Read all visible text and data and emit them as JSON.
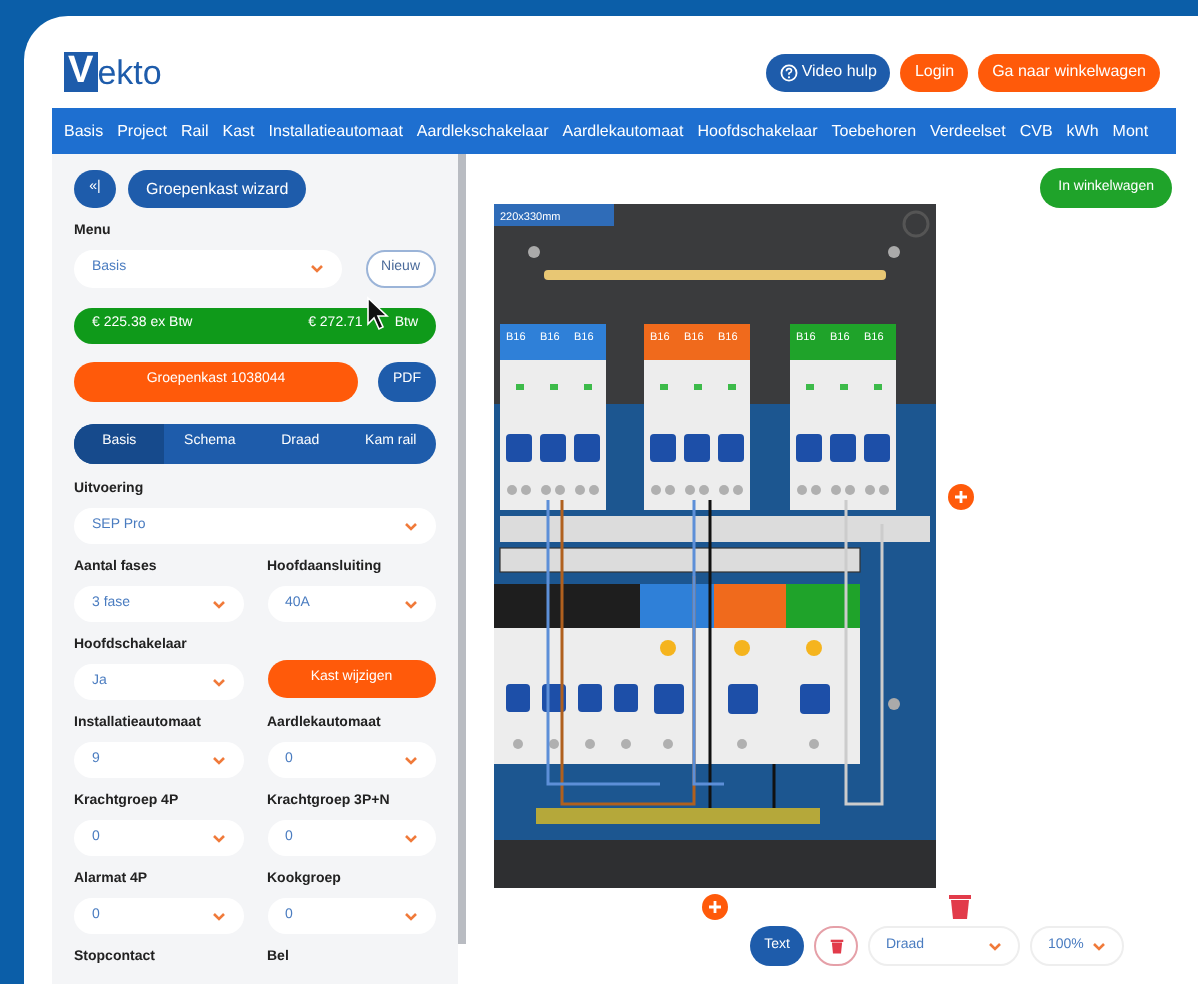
{
  "logo": {
    "initial": "V",
    "rest": "ekto"
  },
  "header_buttons": [
    {
      "label": "Video hulp",
      "kind": "help"
    },
    {
      "label": "Login",
      "kind": "orange"
    },
    {
      "label": "Ga naar winkelwagen",
      "kind": "orange"
    }
  ],
  "nav": [
    "Basis",
    "Project",
    "Rail",
    "Kast",
    "Installatieautomaat",
    "Aardlekschakelaar",
    "Aardlekautomaat",
    "Hoofdschakelaar",
    "Toebehoren",
    "Verdeelset",
    "CVB",
    "kWh",
    "Mont"
  ],
  "sidebar": {
    "collapse_button": "«|",
    "wizard_button": "Groepenkast wizard",
    "menu": {
      "label": "Menu",
      "value": "Basis",
      "new_button": "Nieuw"
    },
    "price": {
      "ex": "€ 225.38 ex Btw",
      "incl": "€ 272.71",
      "suffix": "Btw"
    },
    "project_button": "Groepenkast 1038044",
    "pdf_button": "PDF",
    "tabs": [
      {
        "label": "Basis",
        "selected": true
      },
      {
        "label": "Schema",
        "selected": false
      },
      {
        "label": "Draad",
        "selected": false
      },
      {
        "label": "Kam rail",
        "selected": false
      }
    ],
    "rows": [
      [
        {
          "kind": "select",
          "label": "Uitvoering",
          "value": "SEP Pro"
        }
      ],
      [
        {
          "kind": "select",
          "label": "Aantal fases",
          "value": "3 fase"
        },
        {
          "kind": "select",
          "label": "Hoofdaansluiting",
          "value": "40A"
        }
      ],
      [
        {
          "kind": "select",
          "label": "Hoofdschakelaar",
          "value": "Ja"
        },
        {
          "kind": "button",
          "label": "Kast wijzigen"
        }
      ],
      [
        {
          "kind": "select",
          "label": "Installatieautomaat",
          "value": "9"
        },
        {
          "kind": "select",
          "label": "Aardlekautomaat",
          "value": "0"
        }
      ],
      [
        {
          "kind": "select",
          "label": "Krachtgroep 4P",
          "value": "0"
        },
        {
          "kind": "select",
          "label": "Krachtgroep 3P+N",
          "value": "0"
        }
      ],
      [
        {
          "kind": "select",
          "label": "Alarmat 4P",
          "value": "0"
        },
        {
          "kind": "select",
          "label": "Kookgroep",
          "value": "0"
        }
      ],
      [
        {
          "kind": "label",
          "label": "Stopcontact"
        },
        {
          "kind": "label",
          "label": "Bel"
        }
      ]
    ]
  },
  "canvas": {
    "cart_button": "In winkelwagen",
    "size_label": "220x330mm",
    "module_groups": [
      {
        "color": "#2f80d8",
        "labels": [
          "B16",
          "B16",
          "B16"
        ]
      },
      {
        "color": "#f06a1c",
        "labels": [
          "B16",
          "B16",
          "B16"
        ]
      },
      {
        "color": "#1fa32a",
        "labels": [
          "B16",
          "B16",
          "B16"
        ]
      }
    ]
  },
  "toolbar": {
    "text_button": "Text",
    "wire_select": "Draad",
    "zoom_select": "100%"
  }
}
